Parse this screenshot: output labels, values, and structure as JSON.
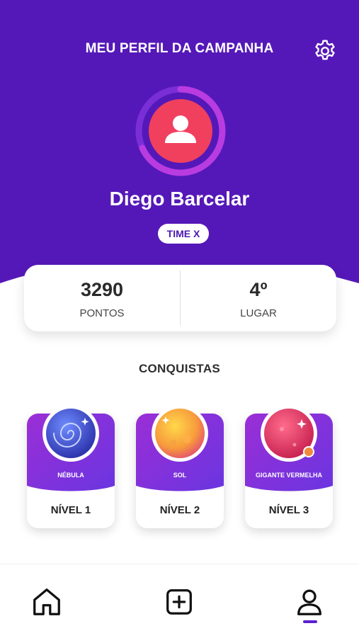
{
  "header": {
    "title": "MEU PERFIL DA CAMPANHA",
    "settings_icon": "gear-icon",
    "background_color": "#5518b8"
  },
  "profile": {
    "name": "Diego Barcelar",
    "team": "TIME X",
    "avatar_icon": "user-icon",
    "avatar_color": "#f0405e"
  },
  "stats": {
    "points_value": "3290",
    "points_label": "PONTOS",
    "rank_value": "4º",
    "rank_label": "LUGAR"
  },
  "achievements": {
    "title": "CONQUISTAS",
    "items": [
      {
        "name": "NÉBULA",
        "level": "NÍVEL 1",
        "icon": "nebula-icon"
      },
      {
        "name": "SOL",
        "level": "NÍVEL 2",
        "icon": "sun-icon"
      },
      {
        "name": "GIGANTE VERMELHA",
        "level": "NÍVEL 3",
        "icon": "red-giant-icon"
      }
    ]
  },
  "nav": {
    "items": [
      {
        "icon": "home-icon"
      },
      {
        "icon": "add-icon"
      },
      {
        "icon": "profile-icon",
        "active": true
      }
    ],
    "accent_color": "#5c1fd0"
  }
}
